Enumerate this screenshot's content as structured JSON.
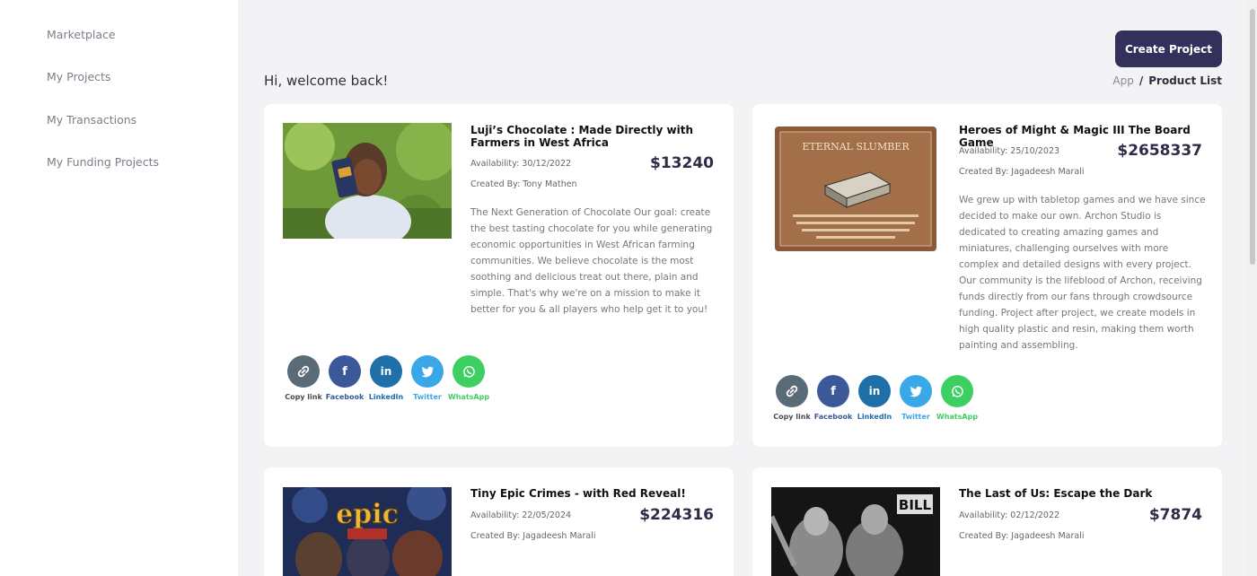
{
  "sidebar": {
    "items": [
      {
        "label": "Marketplace"
      },
      {
        "label": "My Projects"
      },
      {
        "label": "My Transactions"
      },
      {
        "label": "My Funding Projects"
      }
    ]
  },
  "header": {
    "greeting": "Hi, welcome back!",
    "create_label": "Create Project",
    "breadcrumb": {
      "app": "App",
      "sep": "/",
      "current": "Product List"
    }
  },
  "share_labels": {
    "copy": "Copy link",
    "facebook": "Facebook",
    "linkedin": "LinkedIn",
    "twitter": "Twitter",
    "whatsapp": "WhatsApp"
  },
  "projects": [
    {
      "title": "Luji’s Chocolate : Made Directly with Farmers in West Africa",
      "availability": "Availability: 30/12/2022",
      "price": "$13240",
      "creator": "Created By: Tony Mathen",
      "description": "The Next Generation of Chocolate Our goal: create the best tasting chocolate for you while generating economic opportunities in West African farming communities. We believe chocolate is the most soothing and delicious treat out there, plain and simple. That's why we're on a mission to make it better for you & all players who help get it to you!"
    },
    {
      "title": "Heroes of Might & Magic III The Board Game",
      "availability": "Availability: 25/10/2023",
      "price": "$2658337",
      "creator": "Created By: Jagadeesh Marali",
      "description": "We grew up with tabletop games and we have since decided to make our own. Archon Studio is dedicated to creating amazing games and miniatures, challenging ourselves with more complex and detailed designs with every project. Our community is the lifeblood of Archon, receiving funds directly from our fans through crowdsource funding. Project after project, we create models in high quality plastic and resin, making them worth painting and assembling.",
      "image_heading": "ETERNAL SLUMBER"
    },
    {
      "title": "Tiny Epic Crimes - with Red Reveal!",
      "availability": "Availability: 22/05/2024",
      "price": "$224316",
      "creator": "Created By: Jagadeesh Marali"
    },
    {
      "title": "The Last of Us: Escape the Dark",
      "availability": "Availability: 02/12/2022",
      "price": "$7874",
      "creator": "Created By: Jagadeesh Marali",
      "image_badge": "BILL"
    }
  ],
  "colors": {
    "primary": "#33315c",
    "copy": "#5a6b78",
    "facebook": "#3b5998",
    "linkedin": "#1f6fa8",
    "twitter": "#3aa7e8",
    "whatsapp": "#3ecf62"
  }
}
